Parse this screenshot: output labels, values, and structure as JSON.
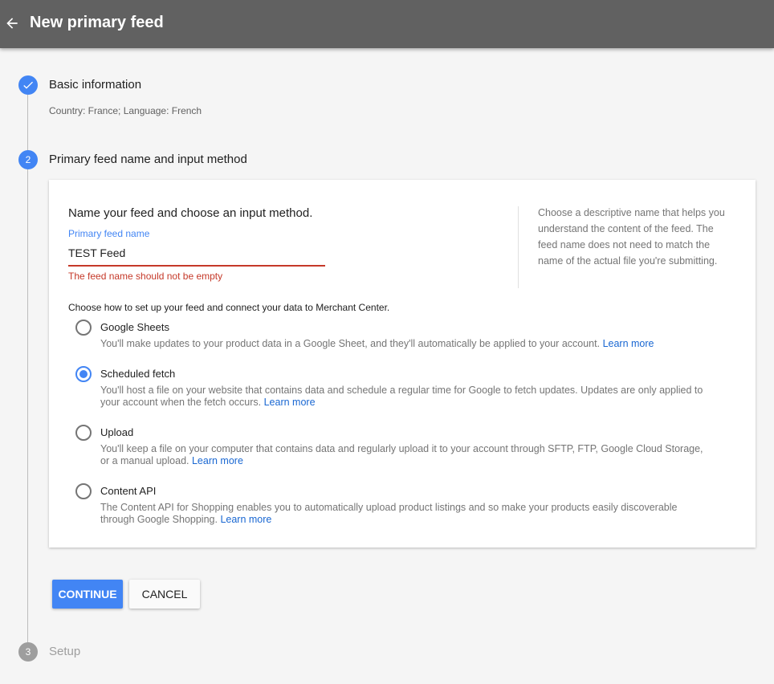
{
  "header": {
    "title": "New primary feed",
    "back_icon": "arrow-left-icon"
  },
  "steps": [
    {
      "number": "",
      "title": "Basic information",
      "subtitle": "Country: France; Language: French",
      "state": "done"
    },
    {
      "number": "2",
      "title": "Primary feed name and input method",
      "state": "active"
    },
    {
      "number": "3",
      "title": "Setup",
      "state": "pending"
    }
  ],
  "card": {
    "heading": "Name your feed and choose an input method.",
    "field_label": "Primary feed name",
    "field_value": "TEST Feed",
    "field_error": "The feed name should not be empty",
    "help_text": "Choose a descriptive name that helps you understand the content of the feed. The feed name does not need to match the name of the actual file you're submitting.",
    "choose_text": "Choose how to set up your feed and connect your data to Merchant Center.",
    "options": [
      {
        "label": "Google Sheets",
        "desc": "You'll make updates to your product data in a Google Sheet, and they'll automatically be applied to your account.",
        "learn": "Learn more",
        "checked": false
      },
      {
        "label": "Scheduled fetch",
        "desc": "You'll host a file on your website that contains data and schedule a regular time for Google to fetch updates. Updates are only applied to your account when the fetch occurs.",
        "learn": "Learn more",
        "checked": true
      },
      {
        "label": "Upload",
        "desc": "You'll keep a file on your computer that contains data and regularly upload it to your account through SFTP, FTP, Google Cloud Storage, or a manual upload.",
        "learn": "Learn more",
        "checked": false
      },
      {
        "label": "Content API",
        "desc": "The Content API for Shopping enables you to automatically upload product listings and so make your products easily discoverable through Google Shopping.",
        "learn": "Learn more",
        "checked": false
      }
    ]
  },
  "buttons": {
    "continue_label": "CONTINUE",
    "cancel_label": "CANCEL"
  },
  "colors": {
    "accent": "#4285f4",
    "error": "#c53929",
    "header": "#616161",
    "link": "#1967d2"
  }
}
